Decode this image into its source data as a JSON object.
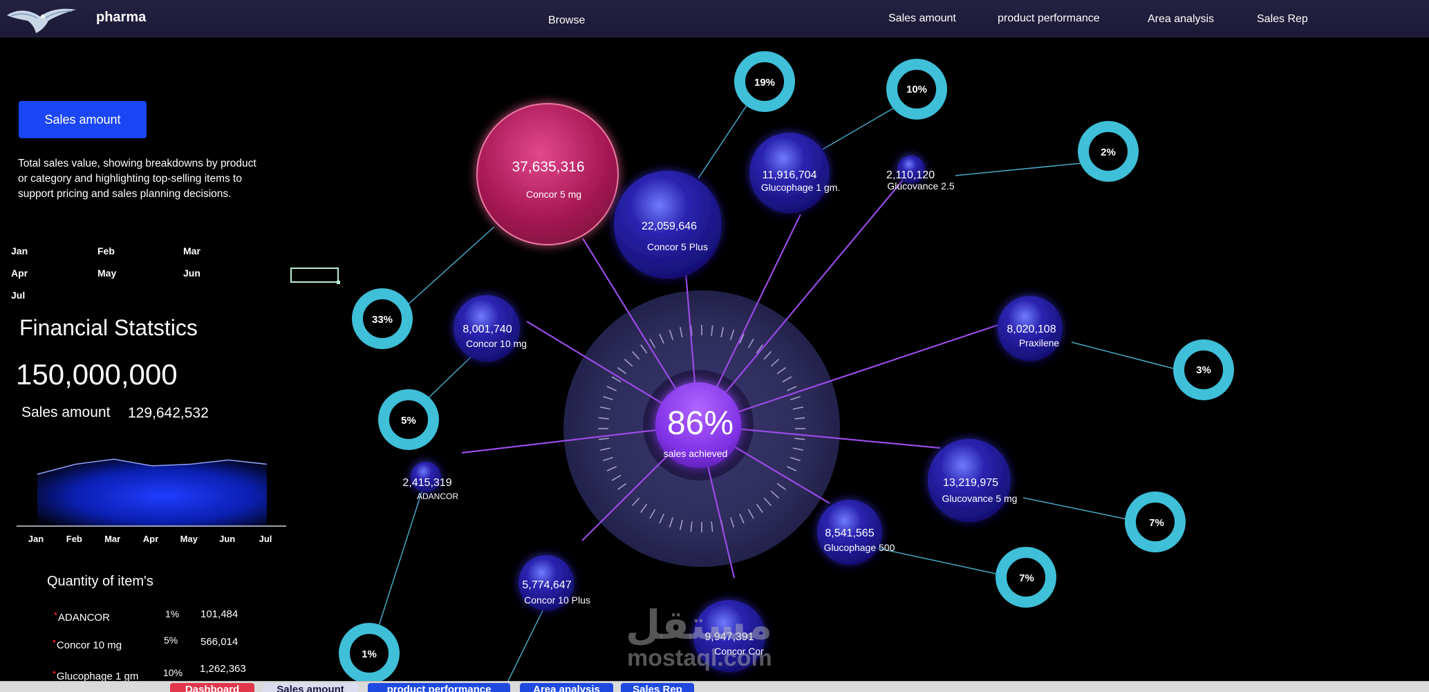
{
  "app": {
    "brand": "pharma"
  },
  "nav": {
    "browse": "Browse",
    "sales_amount": "Sales amount",
    "product_performance": "product performance",
    "area_analysis": "Area analysis",
    "sales_rep": "Sales Rep"
  },
  "left_panel": {
    "button_label": "Sales amount",
    "description": "Total sales value, showing breakdowns by product or category and highlighting top-selling items to support pricing and sales planning decisions.",
    "months": [
      "Jan",
      "Feb",
      "Mar",
      "Apr",
      "May",
      "Jun",
      "Jul"
    ]
  },
  "financial": {
    "title": "Financial Statstics",
    "target": "150,000,000",
    "sales_label": "Sales amount",
    "sales_value": "129,642,532"
  },
  "quantity": {
    "title": "Quantity of item's",
    "items": [
      {
        "name": "ADANCOR",
        "pct": "1%",
        "value": "101,484"
      },
      {
        "name": "Concor 10 mg",
        "pct": "5%",
        "value": "566,014"
      },
      {
        "name": "Glucophage 1 gm",
        "pct": "10%",
        "value": "1,262,363"
      }
    ]
  },
  "center": {
    "percent": "86%",
    "label": "sales achieved"
  },
  "colors": {
    "accent": "#1b46f5",
    "bubble_blue": "#1a1480",
    "bubble_pink": "#b01c58",
    "center_purple": "#8e3df0",
    "ring": "#3fbfd8",
    "connector": "#9a4be6"
  },
  "chart_data": [
    {
      "type": "area",
      "categories": [
        "Jan",
        "Feb",
        "Mar",
        "Apr",
        "May",
        "Jun",
        "Jul"
      ],
      "values": [
        0.62,
        0.74,
        0.8,
        0.72,
        0.74,
        0.79,
        0.74
      ],
      "title": "",
      "xlabel": "",
      "ylabel": "",
      "grid": false,
      "legend": "none"
    },
    {
      "type": "scatter",
      "title": "",
      "bubbles": [
        {
          "name": "Concor 5 mg",
          "value": "37,635,316",
          "pct": "33%",
          "highlight": true
        },
        {
          "name": "Concor 5 Plus",
          "value": "22,059,646",
          "pct": "19%"
        },
        {
          "name": "Glucophage 1 gm.",
          "value": "11,916,704",
          "pct": "10%"
        },
        {
          "name": "Glucovance 2.5",
          "value": "2,110,120",
          "pct": "2%"
        },
        {
          "name": "Concor 10 mg",
          "value": "8,001,740",
          "pct": "5%"
        },
        {
          "name": "Praxilene",
          "value": "8,020,108",
          "pct": "3%"
        },
        {
          "name": "ADANCOR",
          "value": "2,415,319",
          "pct": "1%"
        },
        {
          "name": "Glucovance 5 mg",
          "value": "13,219,975",
          "pct": "7%"
        },
        {
          "name": "Glucophage 500",
          "value": "8,541,565",
          "pct": "7%"
        },
        {
          "name": "Concor 10 Plus",
          "value": "5,774,647",
          "pct": ""
        },
        {
          "name": "Concor Cor",
          "value": "9,947,391",
          "pct": ""
        }
      ]
    }
  ],
  "tabs": [
    {
      "label": "Dashboard",
      "color": "#e2364c"
    },
    {
      "label": "Sales amount",
      "color": "#dcdcf0"
    },
    {
      "label": "product performance",
      "color": "#2049e0"
    },
    {
      "label": "Area analysis",
      "color": "#2049e0"
    },
    {
      "label": "Sales Rep",
      "color": "#2049e0"
    }
  ],
  "watermark": {
    "arabic": "مستقل",
    "latin": "mostaql.com"
  }
}
